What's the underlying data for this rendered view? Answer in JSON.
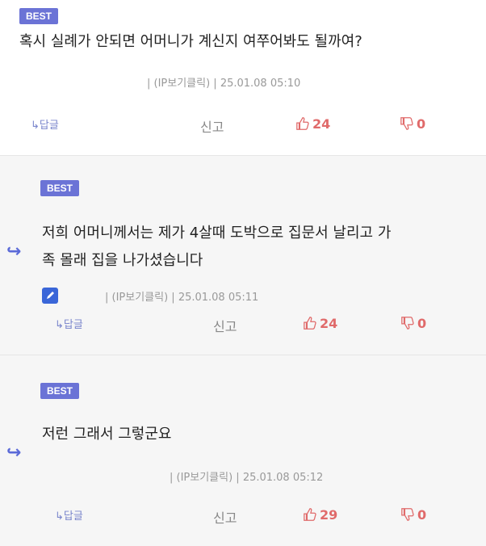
{
  "comments": [
    {
      "badge": "BEST",
      "text": "혹시 실례가 안되면 어머니가 계신지 여쭈어봐도 될까여?",
      "meta": "| (IP보기클릭) | 25.01.08 05:10",
      "reply_label": "↳답글",
      "report_label": "신고",
      "likes": "24",
      "dislikes": "0"
    },
    {
      "badge": "BEST",
      "text_line1": "저희 어머니께서는 제가 4살때 도박으로 집문서 날리고  가",
      "text_line2": "족 몰래 집을 나가셨습니다",
      "meta": "| (IP보기클릭) | 25.01.08 05:11",
      "reply_label": "↳답글",
      "report_label": "신고",
      "likes": "24",
      "dislikes": "0"
    },
    {
      "badge": "BEST",
      "text": "저런 그래서 그렇군요",
      "meta": "| (IP보기클릭) | 25.01.08 05:12",
      "reply_label": "↳답글",
      "report_label": "신고",
      "likes": "29",
      "dislikes": "0"
    }
  ],
  "colors": {
    "badge": "#6b73d6",
    "reply_arrow": "#5b6ad8",
    "count": "#e06a6a"
  }
}
